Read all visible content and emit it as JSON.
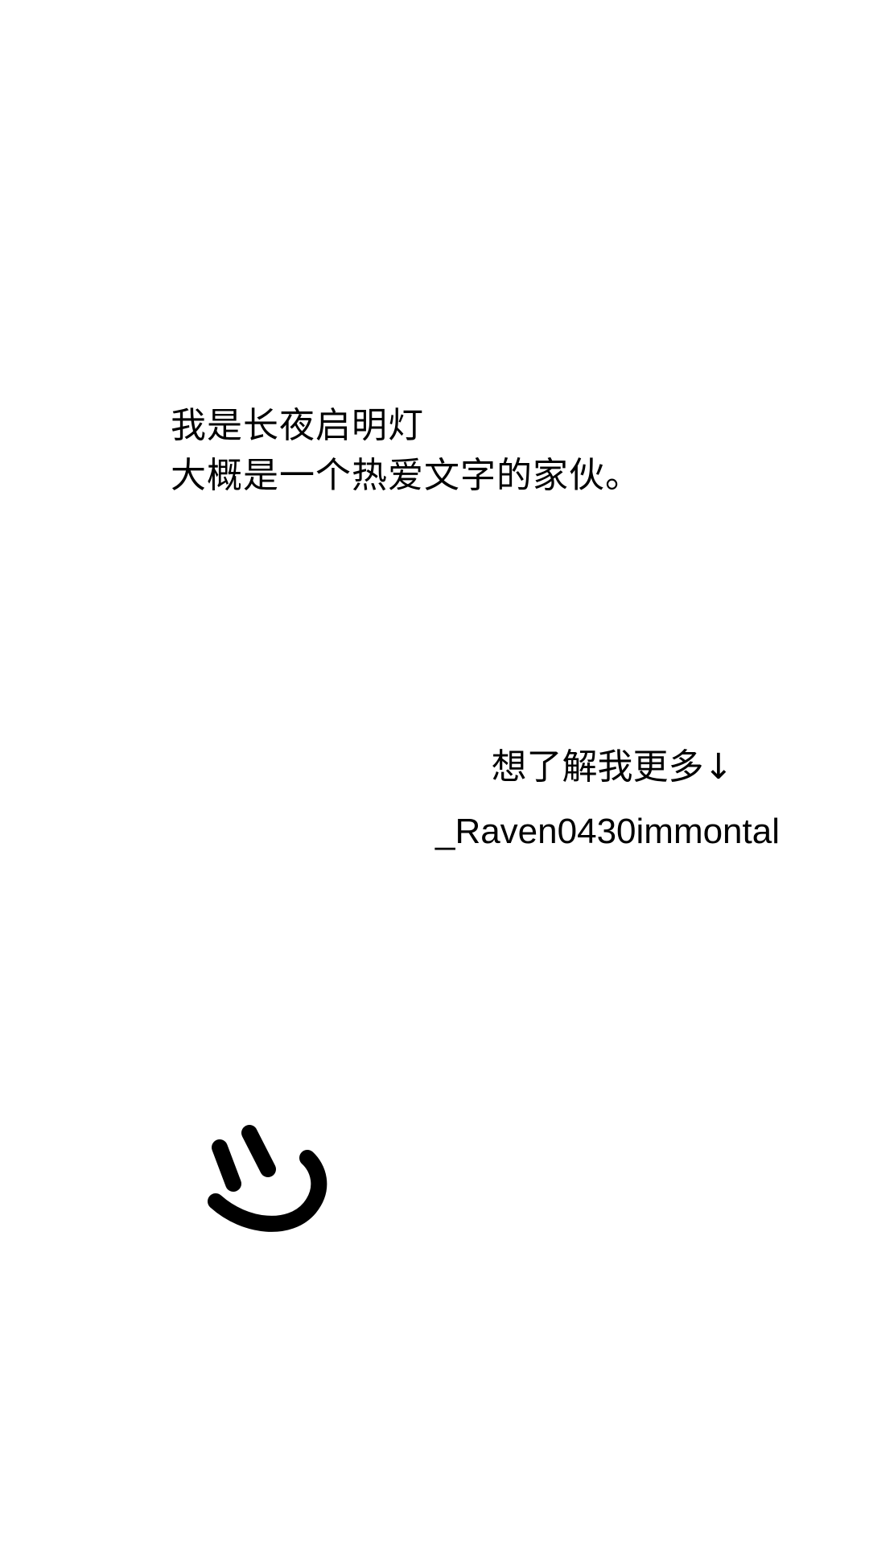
{
  "intro": {
    "line1": "我是长夜启明灯",
    "line2": "大概是一个热爱文字的家伙。"
  },
  "more": {
    "prompt": "想了解我更多↓",
    "handle": "_Raven0430immontal"
  },
  "icons": {
    "smile": "smile-doodle-icon"
  }
}
